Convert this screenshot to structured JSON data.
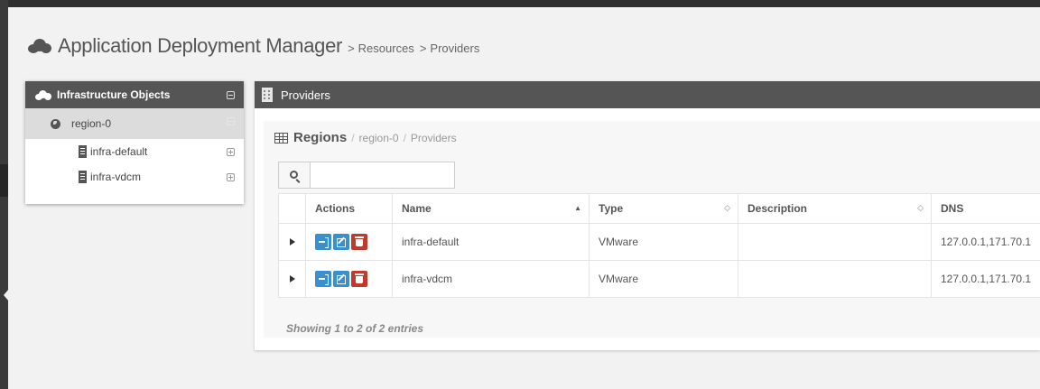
{
  "header": {
    "title": "Application Deployment Manager",
    "breadcrumb": [
      {
        "sep": ">",
        "label": "Resources"
      },
      {
        "sep": ">",
        "label": "Providers"
      }
    ]
  },
  "sidebar": {
    "title": "Infrastructure Objects",
    "region": "region-0",
    "items": [
      {
        "label": "infra-default"
      },
      {
        "label": "infra-vdcm"
      }
    ]
  },
  "panel": {
    "title": "Providers",
    "regions_title": "Regions",
    "breadcrumb": [
      "region-0",
      "Providers"
    ],
    "search": {
      "value": "",
      "placeholder": ""
    },
    "columns": [
      "",
      "Actions",
      "Name",
      "Type",
      "Description",
      "DNS"
    ],
    "rows": [
      {
        "name": "infra-default",
        "type": "VMware",
        "description": "",
        "dns": "127.0.0.1,171.70.1"
      },
      {
        "name": "infra-vdcm",
        "type": "VMware",
        "description": "",
        "dns": "127.0.0.1,171.70.1"
      }
    ],
    "info": "Showing 1 to 2 of 2 entries"
  },
  "icons": {
    "header": "cloud-icon",
    "sidebar": "cloud-icon",
    "region": "globe-icon",
    "node": "server-icon",
    "panel": "building-icon",
    "regions": "table-icon",
    "search": "search-icon",
    "actions": [
      "login-icon",
      "edit-icon",
      "trash-icon"
    ]
  },
  "colors": {
    "header_bar": "#555555",
    "action_blue": "#3a8fd1",
    "action_red": "#c0392b",
    "background": "#f2f2f2"
  }
}
